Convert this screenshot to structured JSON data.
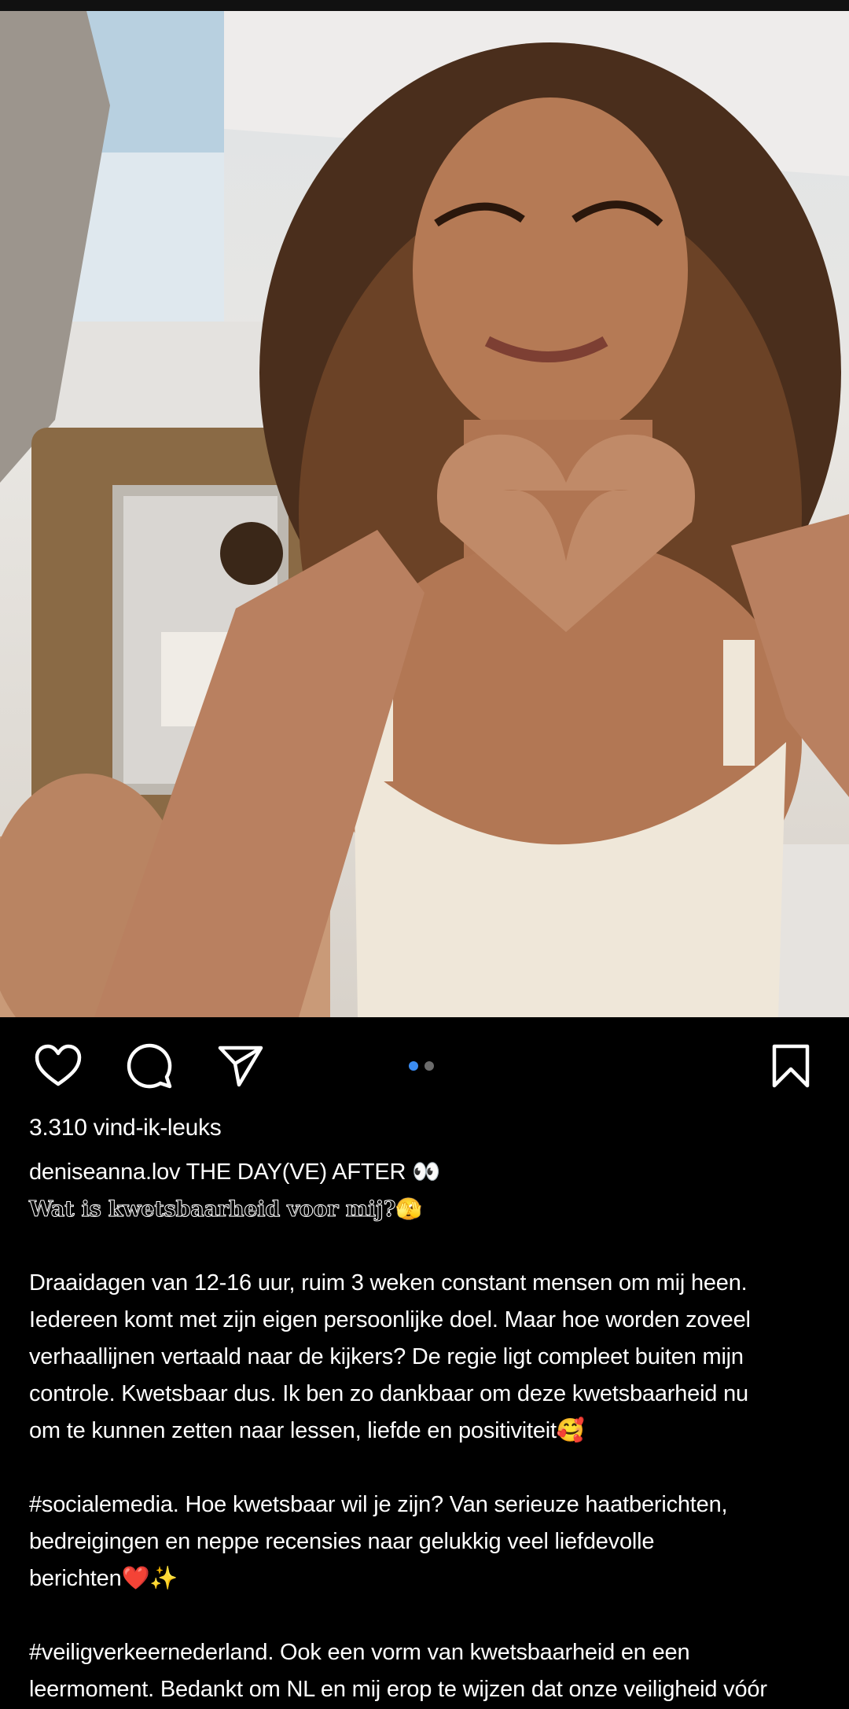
{
  "post": {
    "image_alt": "post-photo",
    "carousel": {
      "count": 2,
      "active": 1
    }
  },
  "actions": {
    "like_icon": "heart-icon",
    "comment_icon": "comment-icon",
    "share_icon": "send-icon",
    "save_icon": "bookmark-icon"
  },
  "likes_text": "3.310 vind-ik-leuks",
  "caption": {
    "username": "deniseanna.lov",
    "first_line": " THE DAY(VE) AFTER 👀",
    "styled_line": "Wat is kwetsbaarheid voor mij?🫣",
    "para1": [
      "Draaidagen van 12-16 uur, ruim 3 weken constant mensen om mij heen.",
      "Iedereen komt met zijn eigen persoonlijke doel. Maar hoe worden zoveel",
      "verhaallijnen vertaald naar de kijkers? De regie ligt compleet buiten mijn",
      "controle. Kwetsbaar dus. Ik ben zo dankbaar om deze kwetsbaarheid nu",
      "om te kunnen zetten naar lessen, liefde en positiviteit🥰"
    ],
    "para2": [
      "#socialemedia. Hoe kwetsbaar wil je zijn? Van serieuze haatberichten,",
      "bedreigingen en neppe recensies naar gelukkig veel liefdevolle",
      "berichten❤️✨"
    ],
    "para3": [
      "#veiligverkeernederland. Ook een vorm van kwetsbaarheid en een",
      "leermoment. Bedankt om NL en mij erop te wijzen dat onze veiligheid vóór"
    ]
  },
  "colors": {
    "background": "#000000",
    "text": "#ffffff",
    "carousel_active": "#3b8cf2",
    "carousel_inactive": "#6b6b6b"
  }
}
